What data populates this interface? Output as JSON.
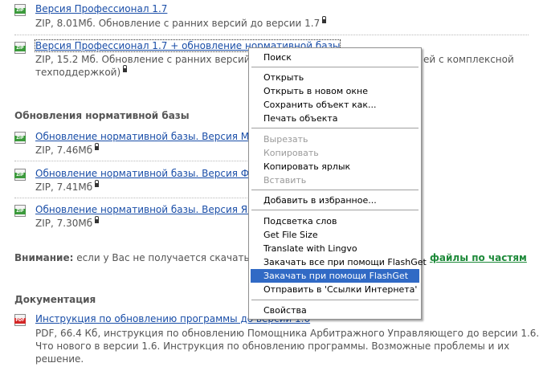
{
  "items": [
    {
      "type": "ZIP",
      "title": "Версия Профессионал 1.7",
      "meta": "ZIP, 8.01Мб. Обновление с ранних версий до версии 1.7"
    },
    {
      "type": "ZIP",
      "title": "Версия Профессионал 1.7 + обновление нормативной базы",
      "meta": "ZIP, 15.2 Мб. Обновление с ранних версий",
      "meta_cont": "ей с комплексной",
      "meta_line2": "техподдержкой)"
    }
  ],
  "sections": {
    "updates_heading": "Обновления нормативной базы",
    "updates": [
      {
        "type": "ZIP",
        "title": "Обновление нормативной базы. Версия Мар",
        "meta": "ZIP, 7.46Мб"
      },
      {
        "type": "ZIP",
        "title": "Обновление нормативной базы. Версия Фев",
        "meta": "ZIP, 7.41Мб"
      },
      {
        "type": "ZIP",
        "title": "Обновление нормативной базы. Версия Янв",
        "meta": "ZIP, 7.30Мб"
      }
    ],
    "attention_label": "Внимание:",
    "attention_text": " если у Вас не получается скачать ф",
    "attention_link": "файлы по частям",
    "docs_heading": "Документация",
    "docs": [
      {
        "type": "PDF",
        "title": "Инструкция по обновлению программы до версии 1.6",
        "meta_lines": [
          "PDF, 66.4 Кб, инструкция по обновлению Помощника Арбитражного Управляющего до версии 1.6.",
          "Что нового в версии 1.6. Инструкция по обновлению программы. Возможные проблемы и их",
          "решение."
        ]
      }
    ]
  },
  "context_menu": {
    "items": [
      {
        "label": "Поиск",
        "state": "normal"
      },
      {
        "sep": true
      },
      {
        "label": "Открыть",
        "state": "normal"
      },
      {
        "label": "Открыть в новом окне",
        "state": "normal"
      },
      {
        "label": "Сохранить объект как...",
        "state": "normal"
      },
      {
        "label": "Печать объекта",
        "state": "normal"
      },
      {
        "sep": true
      },
      {
        "label": "Вырезать",
        "state": "disabled"
      },
      {
        "label": "Копировать",
        "state": "disabled"
      },
      {
        "label": "Копировать ярлык",
        "state": "normal"
      },
      {
        "label": "Вставить",
        "state": "disabled"
      },
      {
        "sep": true
      },
      {
        "label": "Добавить в избранное...",
        "state": "normal"
      },
      {
        "sep": true
      },
      {
        "label": "Подсветка слов",
        "state": "normal"
      },
      {
        "label": "Get File Size",
        "state": "normal"
      },
      {
        "label": "Translate with Lingvo",
        "state": "normal"
      },
      {
        "label": "Закачать все при помощи FlashGet",
        "state": "normal"
      },
      {
        "label": "Закачать при помощи FlashGet",
        "state": "selected"
      },
      {
        "label": "Отправить в 'Ссылки Интернета'",
        "state": "normal"
      },
      {
        "sep": true
      },
      {
        "label": "Свойства",
        "state": "normal"
      }
    ]
  },
  "colors": {
    "link": "#1a4ea8",
    "green_link": "#1e8a3a",
    "menu_highlight": "#316ac5",
    "zip_icon": "#3c9a3c",
    "pdf_icon": "#d32626"
  }
}
